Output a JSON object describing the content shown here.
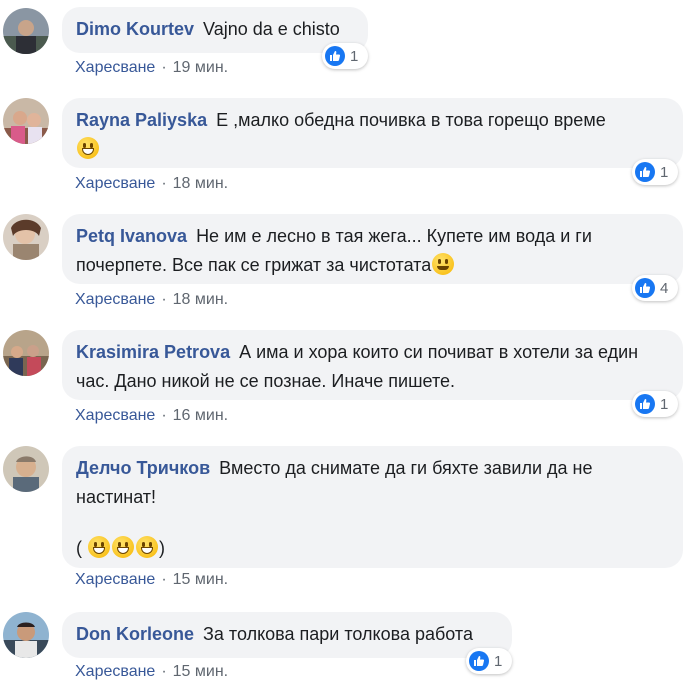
{
  "comments": [
    {
      "author": "Dimo Kourtev",
      "text": "Vajno da e chisto",
      "like_label": "Харесване",
      "separator": "·",
      "time": "19 мин.",
      "reaction_count": "1"
    },
    {
      "author": "Rayna Paliyska",
      "text": "Е ,малко обедна почивка в това горещо време",
      "emoji": "grinning-emoji",
      "like_label": "Харесване",
      "separator": "·",
      "time": "18 мин.",
      "reaction_count": "1"
    },
    {
      "author": "Petq Ivanova",
      "text": "Не им е лесно в тая жега... Купете им вода и ги почерпете. Все пак се грижат за чистотата",
      "emoji": "smiling-emoji",
      "like_label": "Харесване",
      "separator": "·",
      "time": "18 мин.",
      "reaction_count": "4"
    },
    {
      "author": "Krasimira Petrova",
      "text": "А има и хора които си почиват в хотели за един час. Дано никой не се познае. Иначе пишете.",
      "like_label": "Харесване",
      "separator": "·",
      "time": "16 мин.",
      "reaction_count": "1"
    },
    {
      "author": "Делчо Тричков",
      "text": "Вместо да снимате да ги бяхте завили да не настинат!",
      "text2_open": "(",
      "text2_close": ")",
      "emoji": "beaming-emoji",
      "like_label": "Харесване",
      "separator": "·",
      "time": "15 мин."
    },
    {
      "author": "Don Korleone",
      "text": "За толкова пари толкова работа",
      "like_label": "Харесване",
      "separator": "·",
      "time": "15 мин.",
      "reaction_count": "1"
    }
  ],
  "colors": {
    "author": "#385898",
    "bubble": "#f2f3f5",
    "meta": "#606770",
    "like_blue": "#1877f2"
  },
  "icons": {
    "reaction": "thumbs-up-icon"
  }
}
